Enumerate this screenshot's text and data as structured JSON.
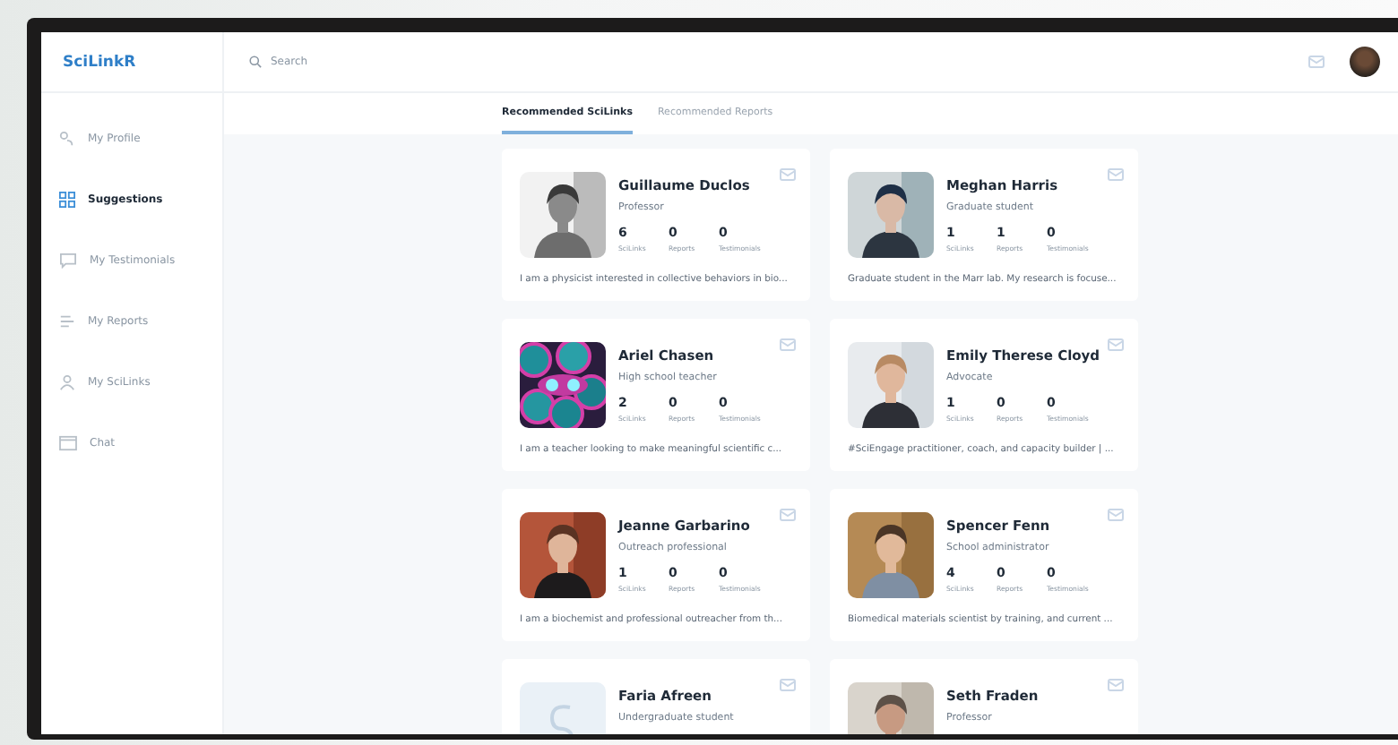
{
  "app": {
    "name": "SciLinkR"
  },
  "search": {
    "placeholder": "Search"
  },
  "nav": {
    "items": [
      {
        "label": "My Profile",
        "selected": false
      },
      {
        "label": "Suggestions",
        "selected": true
      },
      {
        "label": "My Testimonials",
        "selected": false
      },
      {
        "label": "My Reports",
        "selected": false
      },
      {
        "label": "My SciLinks",
        "selected": false
      },
      {
        "label": "Chat",
        "selected": false
      }
    ]
  },
  "tabs": [
    {
      "label": "Recommended SciLinks",
      "selected": true
    },
    {
      "label": "Recommended Reports",
      "selected": false
    }
  ],
  "cards": [
    {
      "kind": "picture",
      "name": "Guillaume Duclos",
      "role": "Professor",
      "stats": [
        {
          "value": "6",
          "label": "SciLinks"
        },
        {
          "value": "0",
          "label": "Reports"
        },
        {
          "value": "0",
          "label": "Testimonials"
        }
      ],
      "bio": "I am a physicist interested in collective behaviors in bio..."
    },
    {
      "kind": "picture",
      "name": "Meghan Harris",
      "role": "Graduate student",
      "stats": [
        {
          "value": "1",
          "label": "SciLinks"
        },
        {
          "value": "1",
          "label": "Reports"
        },
        {
          "value": "0",
          "label": "Testimonials"
        }
      ],
      "bio": "Graduate student in the Marr lab. My research is focuse..."
    },
    {
      "kind": "picture",
      "name": "Ariel Chasen",
      "role": "High school teacher",
      "stats": [
        {
          "value": "2",
          "label": "SciLinks"
        },
        {
          "value": "0",
          "label": "Reports"
        },
        {
          "value": "0",
          "label": "Testimonials"
        }
      ],
      "bio": "I am a teacher looking to make meaningful scientific c..."
    },
    {
      "kind": "picture",
      "name": "Emily Therese Cloyd",
      "role": "Advocate",
      "stats": [
        {
          "value": "1",
          "label": "SciLinks"
        },
        {
          "value": "0",
          "label": "Reports"
        },
        {
          "value": "0",
          "label": "Testimonials"
        }
      ],
      "bio": "#SciEngage practitioner, coach, and capacity builder | ..."
    },
    {
      "kind": "picture",
      "name": "Jeanne Garbarino",
      "role": "Outreach professional",
      "stats": [
        {
          "value": "1",
          "label": "SciLinks"
        },
        {
          "value": "0",
          "label": "Reports"
        },
        {
          "value": "0",
          "label": "Testimonials"
        }
      ],
      "bio": "I am a biochemist and professional outreacher from th..."
    },
    {
      "kind": "picture",
      "name": "Spencer Fenn",
      "role": "School administrator",
      "stats": [
        {
          "value": "4",
          "label": "SciLinks"
        },
        {
          "value": "0",
          "label": "Reports"
        },
        {
          "value": "0",
          "label": "Testimonials"
        }
      ],
      "bio": "Biomedical materials scientist by training, and current ..."
    },
    {
      "kind": "placeholder",
      "name": "Faria Afreen",
      "role": "Undergraduate student"
    },
    {
      "kind": "picture",
      "name": "Seth Fraden",
      "role": "Professor"
    }
  ]
}
